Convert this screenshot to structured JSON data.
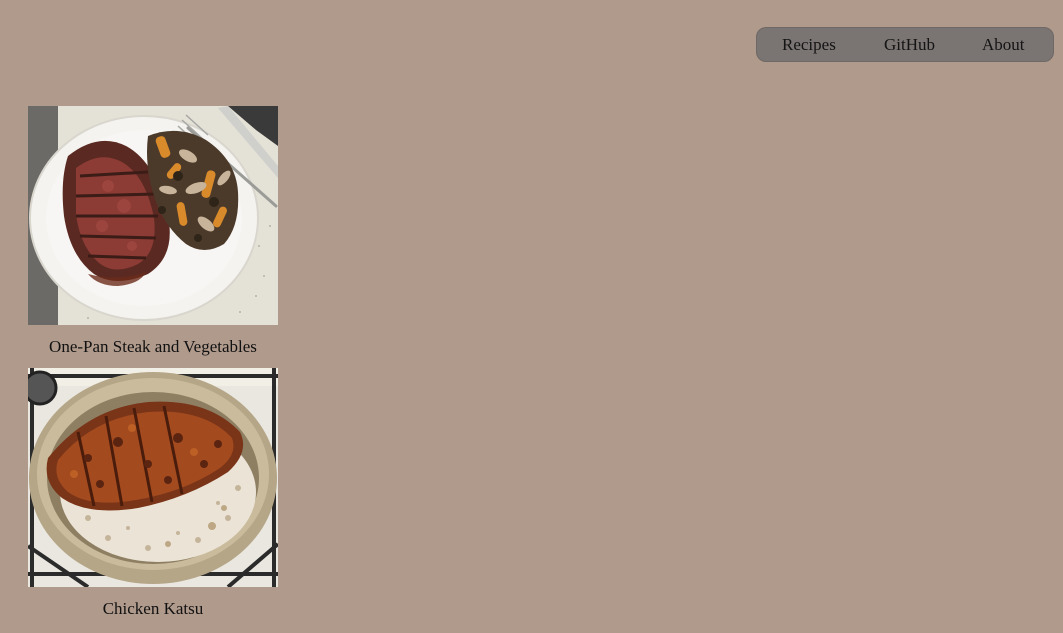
{
  "nav": {
    "items": [
      {
        "label": "Recipes"
      },
      {
        "label": "GitHub"
      },
      {
        "label": "About"
      }
    ]
  },
  "recipes": [
    {
      "title": "One-Pan Steak and Vegetables"
    },
    {
      "title": "Chicken Katsu"
    }
  ],
  "colors": {
    "page_background": "#b09a8c",
    "nav_background": "#7a7472"
  }
}
